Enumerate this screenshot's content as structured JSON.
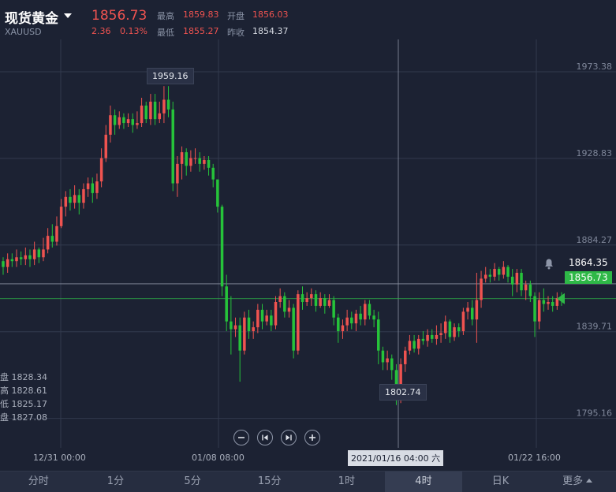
{
  "header": {
    "title": "现货黄金",
    "symbol": "XAUUSD",
    "price": "1856.73",
    "change": "2.36",
    "change_pct": "0.13%",
    "high_label": "最高",
    "high": "1859.83",
    "open_label": "开盘",
    "open": "1856.03",
    "low_label": "最低",
    "low": "1855.27",
    "prev_close_label": "昨收",
    "prev_close": "1854.37"
  },
  "ohlc_legend": [
    "盘 1828.34",
    "高 1828.61",
    "低 1825.17",
    "盘 1827.08"
  ],
  "crosshair": {
    "time_label": "2021/01/16 04:00 六",
    "price_label": "1864.35"
  },
  "current_price_tag": "1856.73",
  "callouts": {
    "max": "1959.16",
    "min": "1802.74"
  },
  "x_axis_labels": [
    "12/31 00:00",
    "01/08 08:00",
    "01/22 16:00"
  ],
  "timeframe_tabs": [
    "分时",
    "1分",
    "5分",
    "15分",
    "1时",
    "4时",
    "日K",
    "更多"
  ],
  "active_tab": "4时",
  "colors": {
    "up": "#ef5350",
    "down": "#26c33a",
    "background": "#1c2233"
  },
  "icons": [
    "zoom-out-icon",
    "scroll-back-icon",
    "scroll-forward-icon",
    "zoom-in-icon",
    "bell-icon",
    "caret-down-icon"
  ],
  "chart_data": {
    "type": "candlestick",
    "y_ticks": [
      1973.38,
      1928.83,
      1884.27,
      1839.71,
      1795.16
    ],
    "ylim": [
      1780,
      1990
    ],
    "grid": true,
    "horizontal_lines": [
      1864.35,
      1856.73
    ],
    "x_ticks": [
      "12/31 00:00",
      "01/08 08:00",
      "01/22 16:00"
    ],
    "candles": [
      [
        1876,
        1873,
        1878,
        1869
      ],
      [
        1873,
        1877,
        1880,
        1870
      ],
      [
        1877,
        1876,
        1880,
        1873
      ],
      [
        1876,
        1878,
        1882,
        1873
      ],
      [
        1878,
        1877,
        1881,
        1874
      ],
      [
        1877,
        1879,
        1883,
        1874
      ],
      [
        1879,
        1877,
        1882,
        1873
      ],
      [
        1877,
        1882,
        1886,
        1874
      ],
      [
        1882,
        1878,
        1883,
        1875
      ],
      [
        1878,
        1882,
        1888,
        1876
      ],
      [
        1882,
        1889,
        1893,
        1880
      ],
      [
        1889,
        1886,
        1895,
        1883
      ],
      [
        1886,
        1894,
        1899,
        1884
      ],
      [
        1894,
        1904,
        1908,
        1893
      ],
      [
        1904,
        1909,
        1912,
        1899
      ],
      [
        1909,
        1906,
        1913,
        1902
      ],
      [
        1906,
        1910,
        1915,
        1903
      ],
      [
        1910,
        1906,
        1913,
        1900
      ],
      [
        1906,
        1913,
        1916,
        1903
      ],
      [
        1913,
        1916,
        1919,
        1909
      ],
      [
        1916,
        1911,
        1919,
        1906
      ],
      [
        1911,
        1917,
        1921,
        1908
      ],
      [
        1917,
        1929,
        1934,
        1914
      ],
      [
        1929,
        1941,
        1946,
        1927
      ],
      [
        1941,
        1951,
        1956,
        1937
      ],
      [
        1951,
        1946,
        1954,
        1941
      ],
      [
        1946,
        1950,
        1953,
        1944
      ],
      [
        1950,
        1947,
        1952,
        1944
      ],
      [
        1947,
        1949,
        1952,
        1945
      ],
      [
        1949,
        1946,
        1952,
        1942
      ],
      [
        1946,
        1947,
        1953,
        1944
      ],
      [
        1947,
        1956,
        1960,
        1945
      ],
      [
        1956,
        1949,
        1958,
        1947
      ],
      [
        1949,
        1958,
        1962,
        1946
      ],
      [
        1958,
        1949,
        1962,
        1946
      ],
      [
        1949,
        1952,
        1958,
        1947
      ],
      [
        1952,
        1959,
        1966,
        1947
      ],
      [
        1959,
        1954,
        1966,
        1950
      ],
      [
        1954,
        1916,
        1958,
        1912
      ],
      [
        1916,
        1926,
        1930,
        1909
      ],
      [
        1926,
        1932,
        1935,
        1918
      ],
      [
        1932,
        1925,
        1934,
        1920
      ],
      [
        1925,
        1929,
        1933,
        1922
      ],
      [
        1929,
        1929,
        1934,
        1926
      ],
      [
        1929,
        1926,
        1932,
        1922
      ],
      [
        1926,
        1928,
        1930,
        1923
      ],
      [
        1928,
        1924,
        1930,
        1920
      ],
      [
        1924,
        1918,
        1926,
        1914
      ],
      [
        1918,
        1904,
        1918,
        1901
      ],
      [
        1904,
        1863,
        1905,
        1858
      ],
      [
        1863,
        1845,
        1869,
        1840
      ],
      [
        1845,
        1841,
        1858,
        1828
      ],
      [
        1841,
        1843,
        1847,
        1837
      ],
      [
        1843,
        1830,
        1847,
        1814
      ],
      [
        1830,
        1847,
        1850,
        1828
      ],
      [
        1847,
        1840,
        1851,
        1836
      ],
      [
        1840,
        1842,
        1845,
        1836
      ],
      [
        1842,
        1851,
        1854,
        1839
      ],
      [
        1851,
        1845,
        1854,
        1841
      ],
      [
        1845,
        1848,
        1851,
        1843
      ],
      [
        1848,
        1843,
        1851,
        1840
      ],
      [
        1843,
        1855,
        1858,
        1841
      ],
      [
        1855,
        1858,
        1862,
        1852
      ],
      [
        1858,
        1850,
        1860,
        1847
      ],
      [
        1850,
        1852,
        1856,
        1847
      ],
      [
        1852,
        1830,
        1854,
        1826
      ],
      [
        1830,
        1859,
        1861,
        1828
      ],
      [
        1859,
        1855,
        1863,
        1851
      ],
      [
        1855,
        1857,
        1860,
        1853
      ],
      [
        1857,
        1859,
        1862,
        1853
      ],
      [
        1859,
        1853,
        1861,
        1850
      ],
      [
        1853,
        1857,
        1860,
        1852
      ],
      [
        1857,
        1853,
        1859,
        1849
      ],
      [
        1853,
        1856,
        1859,
        1852
      ],
      [
        1856,
        1847,
        1858,
        1843
      ],
      [
        1847,
        1840,
        1849,
        1834
      ],
      [
        1840,
        1843,
        1846,
        1836
      ],
      [
        1843,
        1847,
        1851,
        1840
      ],
      [
        1847,
        1844,
        1850,
        1841
      ],
      [
        1844,
        1849,
        1851,
        1840
      ],
      [
        1849,
        1846,
        1853,
        1843
      ],
      [
        1846,
        1854,
        1856,
        1843
      ],
      [
        1854,
        1848,
        1856,
        1846
      ],
      [
        1848,
        1846,
        1851,
        1842
      ],
      [
        1846,
        1830,
        1850,
        1823
      ],
      [
        1830,
        1824,
        1832,
        1820
      ],
      [
        1824,
        1826,
        1830,
        1820
      ],
      [
        1826,
        1820,
        1828,
        1815
      ],
      [
        1820,
        1805,
        1823,
        1802
      ],
      [
        1805,
        1823,
        1826,
        1803
      ],
      [
        1823,
        1830,
        1832,
        1819
      ],
      [
        1830,
        1835,
        1838,
        1828
      ],
      [
        1835,
        1831,
        1838,
        1829
      ],
      [
        1831,
        1836,
        1838,
        1828
      ],
      [
        1836,
        1835,
        1840,
        1833
      ],
      [
        1835,
        1838,
        1841,
        1832
      ],
      [
        1838,
        1836,
        1841,
        1834
      ],
      [
        1836,
        1838,
        1843,
        1833
      ],
      [
        1838,
        1839,
        1844,
        1834
      ],
      [
        1839,
        1845,
        1848,
        1836
      ],
      [
        1845,
        1837,
        1846,
        1834
      ],
      [
        1837,
        1842,
        1844,
        1835
      ],
      [
        1842,
        1840,
        1844,
        1837
      ],
      [
        1840,
        1850,
        1852,
        1838
      ],
      [
        1850,
        1852,
        1855,
        1846
      ],
      [
        1852,
        1846,
        1856,
        1843
      ],
      [
        1846,
        1856,
        1870,
        1834
      ],
      [
        1856,
        1867,
        1871,
        1852
      ],
      [
        1867,
        1869,
        1873,
        1865
      ],
      [
        1869,
        1868,
        1872,
        1865
      ],
      [
        1868,
        1872,
        1875,
        1866
      ],
      [
        1872,
        1869,
        1873,
        1866
      ],
      [
        1869,
        1873,
        1876,
        1867
      ],
      [
        1873,
        1868,
        1874,
        1865
      ],
      [
        1868,
        1864,
        1872,
        1858
      ],
      [
        1864,
        1870,
        1872,
        1860
      ],
      [
        1870,
        1861,
        1872,
        1858
      ],
      [
        1861,
        1864,
        1866,
        1856
      ],
      [
        1864,
        1858,
        1866,
        1855
      ],
      [
        1858,
        1845,
        1860,
        1837
      ],
      [
        1845,
        1856,
        1860,
        1841
      ],
      [
        1856,
        1854,
        1862,
        1850
      ],
      [
        1854,
        1855,
        1858,
        1851
      ],
      [
        1855,
        1853,
        1858,
        1850
      ],
      [
        1853,
        1857,
        1860,
        1851
      ],
      [
        1857,
        1856,
        1860,
        1853
      ]
    ]
  }
}
